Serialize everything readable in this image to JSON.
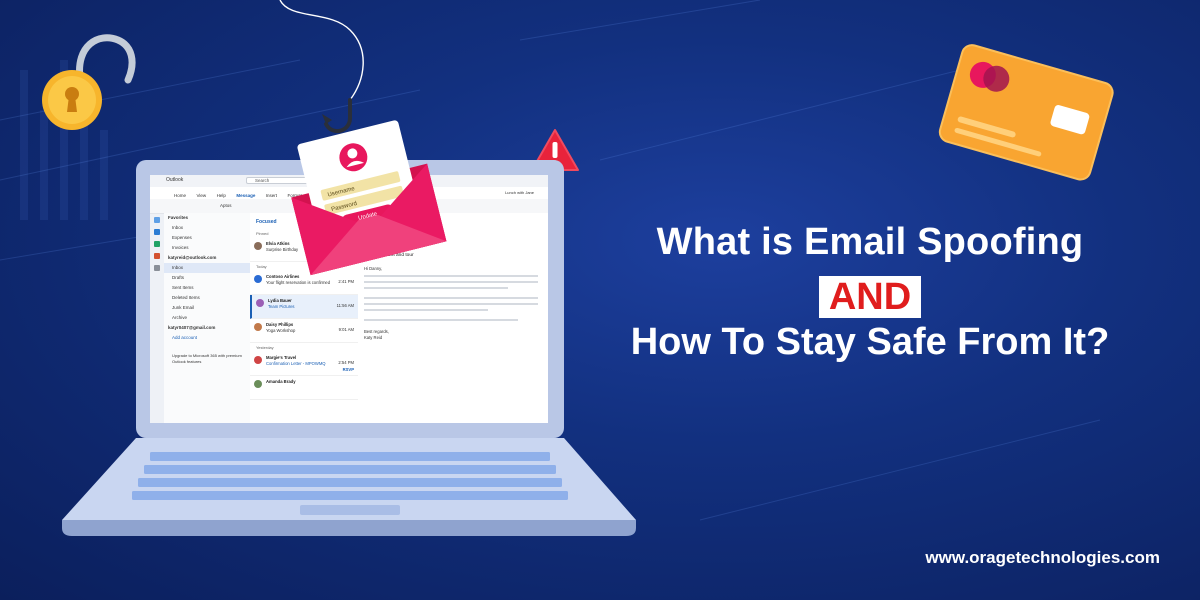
{
  "headline": {
    "line1": "What is Email Spoofing",
    "and": "AND",
    "line3": "How To Stay Safe From It?"
  },
  "website": "www.oragetechnologies.com",
  "colors": {
    "background": "#12307f",
    "and_text": "#e01d1d",
    "envelope": "#e8175d",
    "card": "#f9a531",
    "padlock": "#f7b52c"
  },
  "icons": [
    "padlock-icon",
    "fishing-hook-icon",
    "envelope-icon",
    "warning-icon",
    "credit-card-icon",
    "laptop-icon"
  ],
  "envelope_form": {
    "username": "Username",
    "password": "Password",
    "button": "Update"
  },
  "outlook": {
    "app_name": "Outlook",
    "search": "Search",
    "menu": [
      "Home",
      "View",
      "Help",
      "Message",
      "Insert",
      "Format"
    ],
    "lunch_note": "Lunch with Jane",
    "font": "Aptos",
    "folders": [
      {
        "label": "Favorites",
        "type": "hdr"
      },
      {
        "label": "Inbox",
        "type": "item"
      },
      {
        "label": "Expenses",
        "type": "item"
      },
      {
        "label": "Invoices",
        "type": "item"
      },
      {
        "label": "katyreid@outlook.com",
        "type": "hdr"
      },
      {
        "label": "Inbox",
        "type": "sel"
      },
      {
        "label": "Drafts",
        "type": "item"
      },
      {
        "label": "Sent Items",
        "type": "item"
      },
      {
        "label": "Deleted Items",
        "type": "item"
      },
      {
        "label": "Junk Email",
        "type": "item"
      },
      {
        "label": "Archive",
        "type": "item"
      },
      {
        "label": "katyr0407@gmail.com",
        "type": "hdr"
      },
      {
        "label": "Add account",
        "type": "item"
      }
    ],
    "upgrade_note": "Upgrade to Microsoft 365 with premium Outlook features",
    "tab_focused": "Focused",
    "messages": [
      {
        "name": "Elvia Atkins",
        "line": "Surprise Birthday",
        "time": "",
        "color": "#8a6d5a"
      },
      {
        "name": "Contoso Airlines",
        "line": "Your flight reservation is confirmed",
        "time": "2:41 PM",
        "color": "#2b6cd4"
      },
      {
        "name": "Lydia Bauer",
        "line": "Team Pictures",
        "time": "11:56 AM",
        "color": "#9b5fb5",
        "selected": true
      },
      {
        "name": "Daisy Phillips",
        "line": "Yoga Workshop",
        "time": "9:01 AM",
        "color": "#c27a4b"
      },
      {
        "name": "Margie's Travel",
        "line": "Confirmation Letter - MPOWMQ",
        "time": "2:54 PM",
        "color": "#d04545"
      },
      {
        "name": "Amanda Brady",
        "line": "",
        "time": "",
        "color": "#6b8e5a"
      }
    ],
    "yesterday": "Yesterday",
    "today": "Today",
    "pinned": "Pinned",
    "rsvp": "RSVP",
    "reading_subject": "Re: Apartment and tour",
    "greeting": "Hi Danny,",
    "signoff": "Best regards,",
    "signname": "Katy Reid"
  }
}
